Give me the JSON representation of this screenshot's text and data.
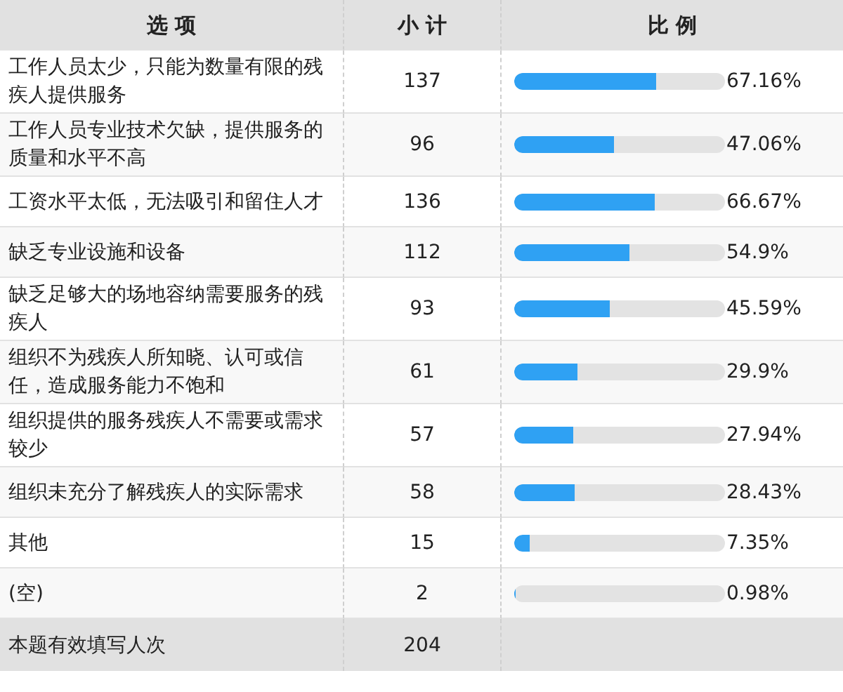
{
  "table": {
    "columns": [
      "选 项",
      "小 计",
      "比 例"
    ],
    "rows": [
      {
        "option": "工作人员太少，只能为数量有限的残疾人提供服务",
        "count": "137",
        "level": 0.6716,
        "percent": "67.16%"
      },
      {
        "option": "工作人员专业技术欠缺，提供服务的质量和水平不高",
        "count": "96",
        "level": 0.4706,
        "percent": "47.06%"
      },
      {
        "option": "工资水平太低，无法吸引和留住人才",
        "count": "136",
        "level": 0.6667,
        "percent": "66.67%"
      },
      {
        "option": "缺乏专业设施和设备",
        "count": "112",
        "level": 0.549,
        "percent": "54.9%"
      },
      {
        "option": "缺乏足够大的场地容纳需要服务的残疾人",
        "count": "93",
        "level": 0.4559,
        "percent": "45.59%"
      },
      {
        "option": "组织不为残疾人所知晓、认可或信任，造成服务能力不饱和",
        "count": "61",
        "level": 0.299,
        "percent": "29.9%"
      },
      {
        "option": "组织提供的服务残疾人不需要或需求较少",
        "count": "57",
        "level": 0.2794,
        "percent": "27.94%"
      },
      {
        "option": "组织未充分了解残疾人的实际需求",
        "count": "58",
        "level": 0.2843,
        "percent": "28.43%"
      },
      {
        "option": "其他",
        "count": "15",
        "level": 0.0735,
        "percent": "7.35%"
      },
      {
        "option": "(空)",
        "count": "2",
        "level": 0.0098,
        "percent": "0.98%"
      }
    ],
    "footer": {
      "label": "本题有效填写人次",
      "count": "204"
    }
  }
}
